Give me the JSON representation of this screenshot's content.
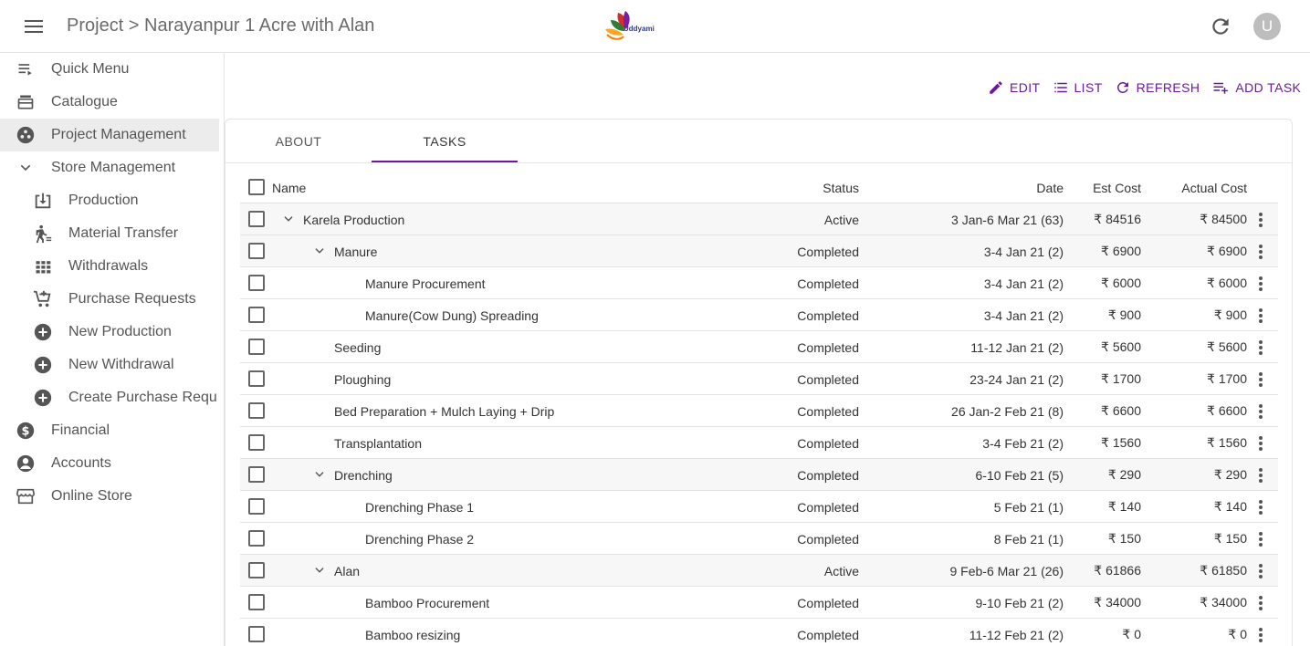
{
  "header": {
    "breadcrumb": "Project > Narayanpur 1 Acre with Alan",
    "logo_text": "Uddyami",
    "avatar_initial": "U"
  },
  "sidebar": {
    "items": [
      {
        "label": "Quick Menu",
        "icon": "quick-menu-icon",
        "level": 0
      },
      {
        "label": "Catalogue",
        "icon": "catalogue-icon",
        "level": 0
      },
      {
        "label": "Project Management",
        "icon": "project-management-icon",
        "level": 0,
        "active": true
      },
      {
        "label": "Store Management",
        "icon": "chevron-down-icon",
        "level": 0
      },
      {
        "label": "Production",
        "icon": "download-box-icon",
        "level": 1
      },
      {
        "label": "Material Transfer",
        "icon": "walking-person-icon",
        "level": 1
      },
      {
        "label": "Withdrawals",
        "icon": "grid-icon",
        "level": 1
      },
      {
        "label": "Purchase Requests",
        "icon": "cart-add-icon",
        "level": 1
      },
      {
        "label": "New Production",
        "icon": "add-circle-icon",
        "level": 1
      },
      {
        "label": "New Withdrawal",
        "icon": "add-circle-icon",
        "level": 1
      },
      {
        "label": "Create Purchase Requ",
        "icon": "add-circle-icon",
        "level": 1
      },
      {
        "label": "Financial",
        "icon": "dollar-circle-icon",
        "level": 0
      },
      {
        "label": "Accounts",
        "icon": "account-circle-icon",
        "level": 0
      },
      {
        "label": "Online Store",
        "icon": "store-icon",
        "level": 0
      }
    ]
  },
  "actions": {
    "edit": "EDIT",
    "list": "LIST",
    "refresh": "REFRESH",
    "add_task": "ADD TASK"
  },
  "tabs": {
    "about": "ABOUT",
    "tasks": "TASKS",
    "active": "TASKS"
  },
  "table": {
    "headers": {
      "name": "Name",
      "status": "Status",
      "date": "Date",
      "est_cost": "Est Cost",
      "actual_cost": "Actual Cost"
    },
    "rows": [
      {
        "name": "Karela Production",
        "status": "Active",
        "date": "3 Jan-6 Mar 21 (63)",
        "est": "₹ 84516",
        "act": "₹ 84500",
        "indent": 0,
        "group": true
      },
      {
        "name": "Manure",
        "status": "Completed",
        "date": "3-4 Jan 21 (2)",
        "est": "₹ 6900",
        "act": "₹ 6900",
        "indent": 1,
        "group": true
      },
      {
        "name": "Manure Procurement",
        "status": "Completed",
        "date": "3-4 Jan 21 (2)",
        "est": "₹ 6000",
        "act": "₹ 6000",
        "indent": 2,
        "group": false
      },
      {
        "name": "Manure(Cow Dung) Spreading",
        "status": "Completed",
        "date": "3-4 Jan 21 (2)",
        "est": "₹ 900",
        "act": "₹ 900",
        "indent": 2,
        "group": false
      },
      {
        "name": "Seeding",
        "status": "Completed",
        "date": "11-12 Jan 21 (2)",
        "est": "₹ 5600",
        "act": "₹ 5600",
        "indent": 1,
        "group": false
      },
      {
        "name": "Ploughing",
        "status": "Completed",
        "date": "23-24 Jan 21 (2)",
        "est": "₹ 1700",
        "act": "₹ 1700",
        "indent": 1,
        "group": false
      },
      {
        "name": "Bed Preparation + Mulch Laying + Drip",
        "status": "Completed",
        "date": "26 Jan-2 Feb 21 (8)",
        "est": "₹ 6600",
        "act": "₹ 6600",
        "indent": 1,
        "group": false
      },
      {
        "name": "Transplantation",
        "status": "Completed",
        "date": "3-4 Feb 21 (2)",
        "est": "₹ 1560",
        "act": "₹ 1560",
        "indent": 1,
        "group": false
      },
      {
        "name": "Drenching",
        "status": "Completed",
        "date": "6-10 Feb 21 (5)",
        "est": "₹ 290",
        "act": "₹ 290",
        "indent": 1,
        "group": true
      },
      {
        "name": "Drenching Phase 1",
        "status": "Completed",
        "date": "5 Feb 21 (1)",
        "est": "₹ 140",
        "act": "₹ 140",
        "indent": 2,
        "group": false
      },
      {
        "name": "Drenching Phase 2",
        "status": "Completed",
        "date": "8 Feb 21 (1)",
        "est": "₹ 150",
        "act": "₹ 150",
        "indent": 2,
        "group": false
      },
      {
        "name": "Alan",
        "status": "Active",
        "date": "9 Feb-6 Mar 21 (26)",
        "est": "₹ 61866",
        "act": "₹ 61850",
        "indent": 1,
        "group": true
      },
      {
        "name": "Bamboo Procurement",
        "status": "Completed",
        "date": "9-10 Feb 21 (2)",
        "est": "₹ 34000",
        "act": "₹ 34000",
        "indent": 2,
        "group": false
      },
      {
        "name": "Bamboo resizing",
        "status": "Completed",
        "date": "11-12 Feb 21 (2)",
        "est": "₹ 0",
        "act": "₹ 0",
        "indent": 2,
        "group": false
      }
    ]
  },
  "colors": {
    "accent": "#6a1b9a",
    "active_nav": "#ececec",
    "avatar_bg": "#bdbdbd"
  }
}
